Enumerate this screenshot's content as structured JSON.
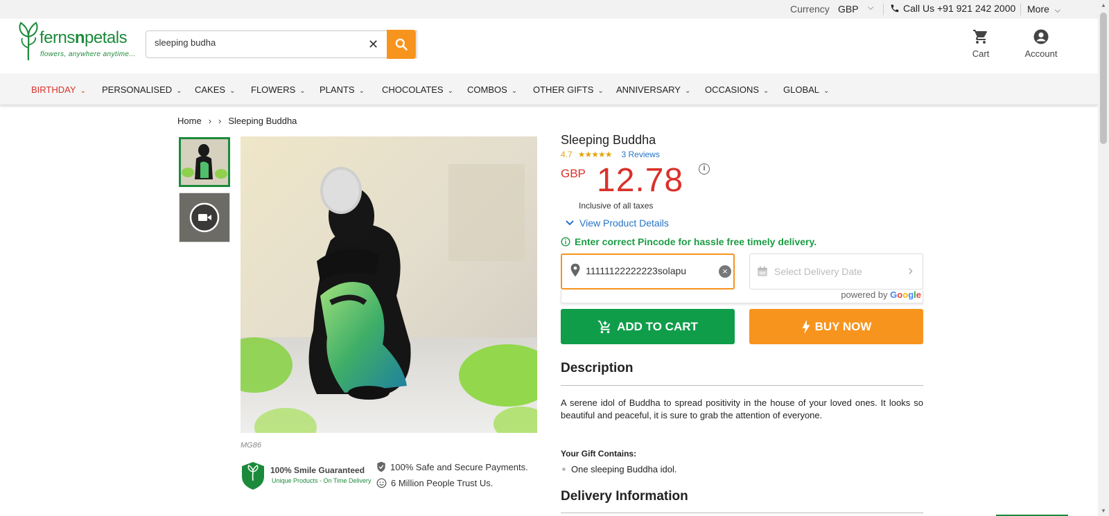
{
  "topbar": {
    "currency_label": "Currency",
    "currency_value": "GBP",
    "call_label": "Call Us +91 921 242 2000",
    "more_label": "More"
  },
  "header": {
    "brand_pre": "ferns",
    "brand_n": "n",
    "brand_post": "petals",
    "tagline": "flowers, anywhere anytime...",
    "search_value": "sleeping budha",
    "cart_label": "Cart",
    "account_label": "Account"
  },
  "nav": {
    "items": [
      "BIRTHDAY",
      "PERSONALISED",
      "CAKES",
      "FLOWERS",
      "PLANTS",
      "CHOCOLATES",
      "COMBOS",
      "OTHER GIFTS",
      "ANNIVERSARY",
      "OCCASIONS",
      "GLOBAL"
    ]
  },
  "breadcrumb": {
    "home": "Home",
    "current": "Sleeping Buddha"
  },
  "gallery": {
    "sku": "MG86"
  },
  "badges": {
    "smile_title": "100% Smile Guaranteed",
    "smile_sub": "Unique Products - On Time Delivery",
    "safe": "100% Safe and Secure Payments.",
    "trust": "6 Million People Trust Us."
  },
  "product": {
    "title": "Sleeping Buddha",
    "rating": "4.7",
    "stars": "★★★★★",
    "reviews": "3 Reviews",
    "currency": "GBP",
    "price": "12.78",
    "tax_note": "Inclusive of all taxes",
    "view_details": "View Product Details",
    "pincode_note": "Enter correct Pincode for hassle free timely delivery.",
    "pincode_value": "11111122222223solapu",
    "delivery_placeholder": "Select Delivery Date",
    "powered_by": "powered by",
    "add_to_cart": "ADD TO CART",
    "buy_now": "BUY NOW"
  },
  "description": {
    "heading": "Description",
    "text": "A serene idol of Buddha to spread positivity in the house of your loved ones. It looks so beautiful and peaceful, it is sure to grab the attention of everyone.",
    "gift_heading": "Your Gift Contains:",
    "gift_items": [
      "One sleeping Buddha idol."
    ]
  },
  "delivery": {
    "heading": "Delivery Information"
  },
  "colors": {
    "brand_green": "#1b8a3a",
    "accent_orange": "#f7941d",
    "price_red": "#d9312a",
    "link_blue": "#2673c6",
    "cart_green": "#0f9d4a"
  }
}
